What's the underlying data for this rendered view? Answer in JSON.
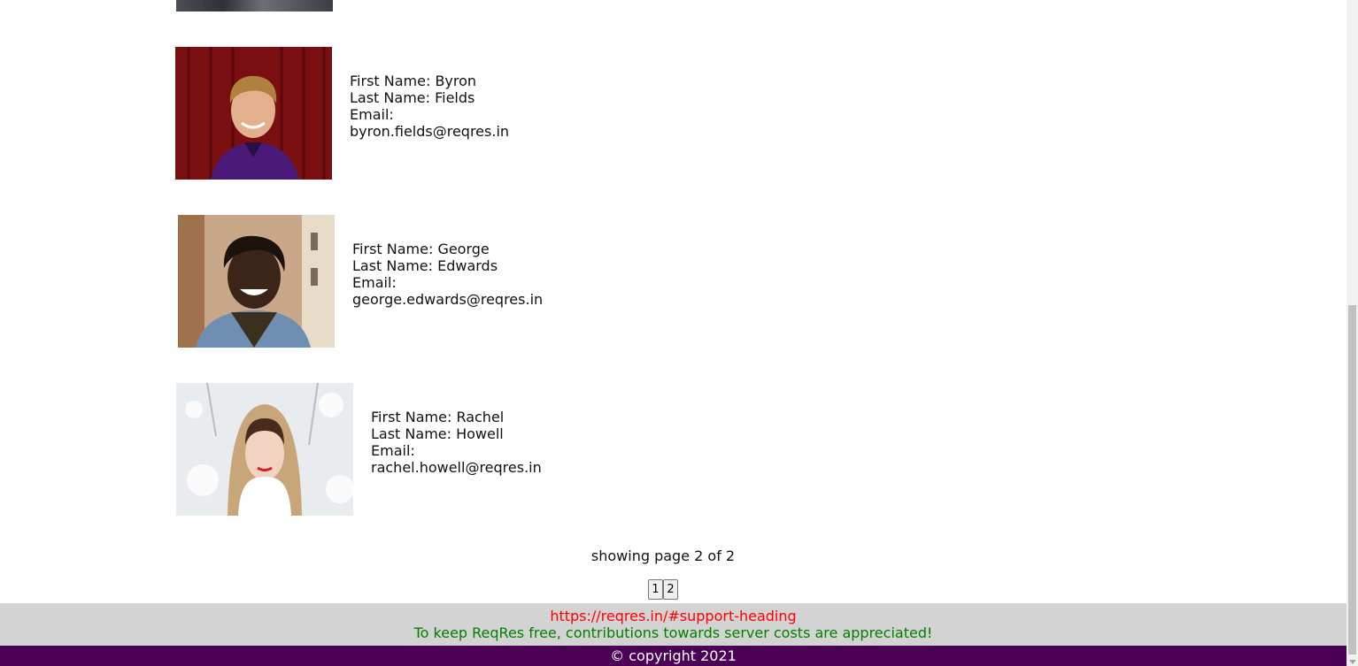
{
  "users": [
    {
      "first_name_line": "First Name: Byron",
      "last_name_line": "Last Name: Fields",
      "email_label": "Email:",
      "email": "byron.fields@reqres.in"
    },
    {
      "first_name_line": "First Name: George",
      "last_name_line": "Last Name: Edwards",
      "email_label": "Email:",
      "email": "george.edwards@reqres.in"
    },
    {
      "first_name_line": "First Name: Rachel",
      "last_name_line": "Last Name: Howell",
      "email_label": "Email:",
      "email": "rachel.howell@reqres.in"
    }
  ],
  "pagination": {
    "status": "showing page 2 of 2",
    "pages": [
      "1",
      "2"
    ]
  },
  "footer": {
    "support_link": "https://reqres.in/#support-heading",
    "note": "To keep ReqRes free, contributions towards server costs are appreciated!",
    "copyright": "© copyright 2021"
  },
  "colors": {
    "footer_bg": "#d3d3d3",
    "link": "#ff0000",
    "note": "#008000",
    "copyright_bg": "#4b0055"
  }
}
